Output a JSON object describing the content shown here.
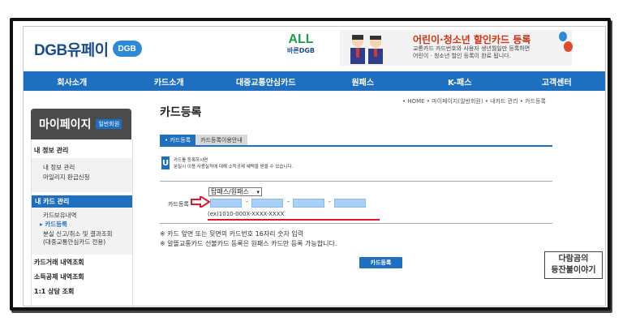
{
  "header": {
    "logo_text": "DGB유페이",
    "logo_badge": "DGB",
    "all_text": "ALL",
    "all_sub": "바른DGB",
    "banner_title": "어린이·청소년 할인카드 등록",
    "banner_desc_1": "교통카드 카드번호와 사용자 생년월일만 등록하면",
    "banner_desc_2": "어린이 · 청소년 할인 등록이 완료 됩니다."
  },
  "nav": [
    "회사소개",
    "카드소개",
    "대중교통안심카드",
    "원패스",
    "K-패스",
    "고객센터"
  ],
  "sidebar": {
    "title": "마이페이지",
    "badge": "일반회원",
    "my_info": "내 정보 관리",
    "my_info_items": [
      "내 정보 관리",
      "마일리지 환급신청"
    ],
    "my_card": "내 카드 관리",
    "card_items": [
      "카드보유내역",
      "카드등록",
      "분실 신고/취소 및 결과조회",
      "(대중교통안심카드 전용)"
    ],
    "card_tx": "카드거래 내역조회",
    "tax": "소득공제 내역조회",
    "qna": "1:1 상담 조회"
  },
  "content": {
    "title": "카드등록",
    "breadcrumb": "• HOME • 마이페이지(일반회원) • 내카드 관리 • 카드등록",
    "tab_on": "• 카드등록",
    "tab_off": "카드등록이용안내",
    "notice_icon": "U",
    "notice_1": "카드를 등록하시면",
    "notice_2": "분실시 이용 사용실적에 대해 소득공제 혜택을 받을 수 있습니다.",
    "form_label": "카드등록",
    "select_value": "탑패스/원패스",
    "example": "(ex)1010-000X-XXXX-XXXX",
    "note_1": "※ 카드 앞면 또는 뒷면의 카드번호 16자리 숫자 입력",
    "note_2": "※ 알뜰교통카드 선불카드 등록은 원패스 카드만 등록 가능합니다.",
    "register_button": "카드등록"
  },
  "watermark": [
    "다람곰의",
    "등잔불이야기"
  ],
  "colors": {
    "brand_blue": "#1e6fc0",
    "accent_red": "#e0182d",
    "input_blue": "#a9d1f5"
  }
}
